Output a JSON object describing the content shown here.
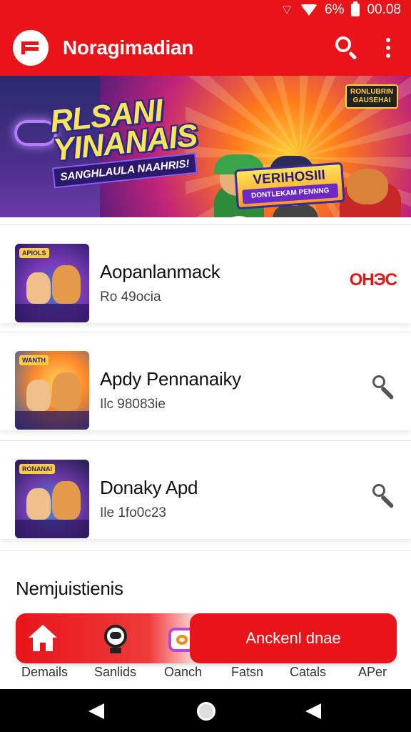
{
  "status_bar": {
    "battery_text": "6%",
    "time": "00.08"
  },
  "app_bar": {
    "title": "Noragimadian"
  },
  "banner": {
    "headline": "RLSANI YINANAIS",
    "subline": "SANGHLAULA NAAHRIS!",
    "badge_main": "VERIHOSIII",
    "badge_sub": "DONTLEKAM PENNNG",
    "corner_label": "RONLUBRIN GAUSEHAI"
  },
  "list": {
    "items": [
      {
        "title": "Aopanlanmack",
        "subtitle": "Ro 49ocia",
        "action": "text",
        "action_label": "ОНЭС",
        "thumb_label": "APIOLS"
      },
      {
        "title": "Apdy Pennanaiky",
        "subtitle": "Ilc 98083ie",
        "action": "icon",
        "action_label": "",
        "thumb_label": "WANTH"
      },
      {
        "title": "Donaky Apd",
        "subtitle": "Ile 1fo0c23",
        "action": "icon",
        "action_label": "",
        "thumb_label": "RONANAI"
      }
    ]
  },
  "section": {
    "title": "Nemjuistienis"
  },
  "bottom_nav": {
    "cta_label": "Anckenl dnae",
    "labels": [
      "Demails",
      "Sanlids",
      "Oanch",
      "Fatsn",
      "Catals",
      "APer"
    ]
  },
  "colors": {
    "primary": "#e8141a",
    "text": "#111111"
  },
  "icons": {
    "logo": "app-logo-icon",
    "search": "search-icon",
    "more": "more-vert-icon",
    "row_action": "wrench-icon",
    "home": "home-icon",
    "person": "person-icon",
    "camera": "camera-icon"
  }
}
